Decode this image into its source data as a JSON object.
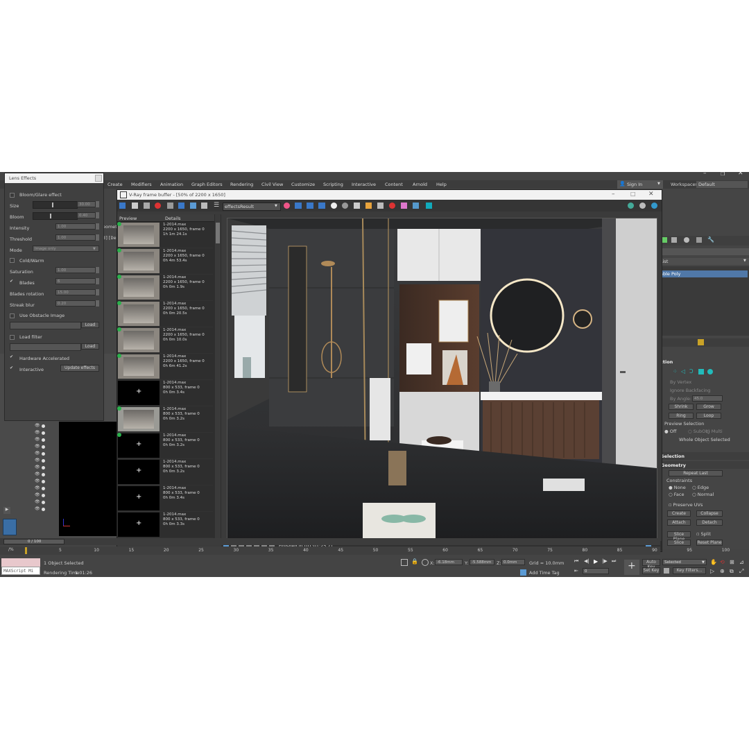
{
  "lens_effects": {
    "title": "Lens Effects",
    "bloom_glare": "Bloom/Glare effect",
    "size_label": "Size",
    "size_value": "30.00",
    "bloom_label": "Bloom",
    "bloom_value": "0.40",
    "intensity_label": "Intensity",
    "intensity_value": "1.00",
    "threshold_label": "Threshold",
    "threshold_value": "1.00",
    "mode_label": "Mode",
    "mode_value": "Image only",
    "cold_warm": "Cold/Warm",
    "saturation_label": "Saturation",
    "saturation_value": "1.00",
    "blades_label": "Blades",
    "blades_value": "6",
    "blades_rotation_label": "Blades rotation",
    "blades_rotation_value": "15.00",
    "streak_blur_label": "Streak blur",
    "streak_blur_value": "0.20",
    "obstacle_label": "Use Obstacle Image",
    "load_label": "Load",
    "load_filter_label": "Load filter",
    "hardware_label": "Hardware Accelerated",
    "interactive_label": "Interactive",
    "update_label": "Update effects"
  },
  "menu": [
    "Create",
    "Modifiers",
    "Animation",
    "Graph Editors",
    "Rendering",
    "Civil View",
    "Customize",
    "Scripting",
    "Interactive",
    "Content",
    "Arnold",
    "Help"
  ],
  "sign_in": "Sign In",
  "workspaces_label": "Workspaces:",
  "workspaces_value": "Default",
  "vfb": {
    "title": "V-Ray frame buffer - [50% of 2200 x 1650]",
    "channel": "effectsResult",
    "status": "Finished in [01:01:25.7]",
    "preview_header": "Preview",
    "details_header": "Details"
  },
  "history": [
    {
      "file": "1-2014.max",
      "res": "2200 x 1650, frame 0",
      "time": "1h 1m 24.1s"
    },
    {
      "file": "1-2014.max",
      "res": "2200 x 1650, frame 0",
      "time": "0h 4m 53.4s"
    },
    {
      "file": "1-2014.max",
      "res": "2200 x 1650, frame 0",
      "time": "0h 0m 1.9s"
    },
    {
      "file": "1-2014.max",
      "res": "2200 x 1650, frame 0",
      "time": "0h 0m 20.5s"
    },
    {
      "file": "1-2014.max",
      "res": "2200 x 1650, frame 0",
      "time": "0h 0m 10.0s"
    },
    {
      "file": "1-2014.max",
      "res": "2200 x 1650, frame 0",
      "time": "0h 6m 41.2s"
    },
    {
      "file": "1-2014.max",
      "res": "800 x 533, frame 0",
      "time": "0h 0m 3.4s"
    },
    {
      "file": "1-2014.max",
      "res": "800 x 533, frame 0",
      "time": "0h 0m 3.2s"
    },
    {
      "file": "1-2014.max",
      "res": "800 x 533, frame 0",
      "time": "0h 0m 3.2s"
    },
    {
      "file": "1-2014.max",
      "res": "800 x 533, frame 0",
      "time": "0h 0m 3.2s"
    },
    {
      "file": "1-2014.max",
      "res": "800 x 533, frame 0",
      "time": "0h 0m 3.4s"
    },
    {
      "file": "1-2014.max",
      "res": "800 x 533, frame 0",
      "time": "0h 0m 3.3s"
    },
    {
      "file": "1-2014.max",
      "res": "1920 x 1080, frame 0",
      "time": ""
    }
  ],
  "right_panel": {
    "list_label": "List",
    "editable_poly": "able Poly",
    "selection_partial": "ction",
    "by_vertex": "By Vertex",
    "ignore_backfacing": "Ignore Backfacing",
    "by_angle": "By Angle:",
    "by_angle_value": "45.0",
    "shrink": "Shrink",
    "grow": "Grow",
    "ring": "Ring",
    "loop": "Loop",
    "preview_selection": "Preview Selection",
    "off": "Off",
    "subobj": "SubObj",
    "multi": "Multi",
    "whole_object": "Whole Object Selected",
    "selection_header": "Selection",
    "geometry_header": "Geometry",
    "repeat_last": "Repeat Last",
    "constraints": "Constraints",
    "none": "None",
    "edge": "Edge",
    "face": "Face",
    "normal": "Normal",
    "preserve_uvs": "Preserve UVs",
    "create": "Create",
    "collapse": "Collapse",
    "attach": "Attach",
    "detach": "Detach",
    "slice_plane": "Slice Plane",
    "split": "Split",
    "slice": "Slice",
    "reset_plane": "Reset Plane"
  },
  "status": {
    "frame_counter": "0 / 100",
    "selected": "1 Object Selected",
    "rendering_time_label": "Rendering Time",
    "rendering_time": "1:01:26",
    "maxscript": "MAXScript Mi",
    "x_label": "X:",
    "x_value": "-6.18mm",
    "y_label": "Y:",
    "y_value": "-5.588mm",
    "z_label": "Z:",
    "z_value": "0.0mm",
    "grid": "Grid = 10.0mm",
    "add_time_tag": "Add Time Tag",
    "auto_key": "Auto Key",
    "set_key": "Set Key",
    "selected_dd": "Selected",
    "key_filters": "Key Filters...",
    "frame_value": "0"
  },
  "timeline_ticks": [
    "5",
    "10",
    "15",
    "20",
    "25",
    "30",
    "35",
    "40",
    "45",
    "50",
    "55",
    "60",
    "65",
    "70",
    "75",
    "80",
    "85",
    "90",
    "95",
    "100"
  ],
  "left_snippets": {
    "geom": "eomet",
    "code": "d][De"
  }
}
